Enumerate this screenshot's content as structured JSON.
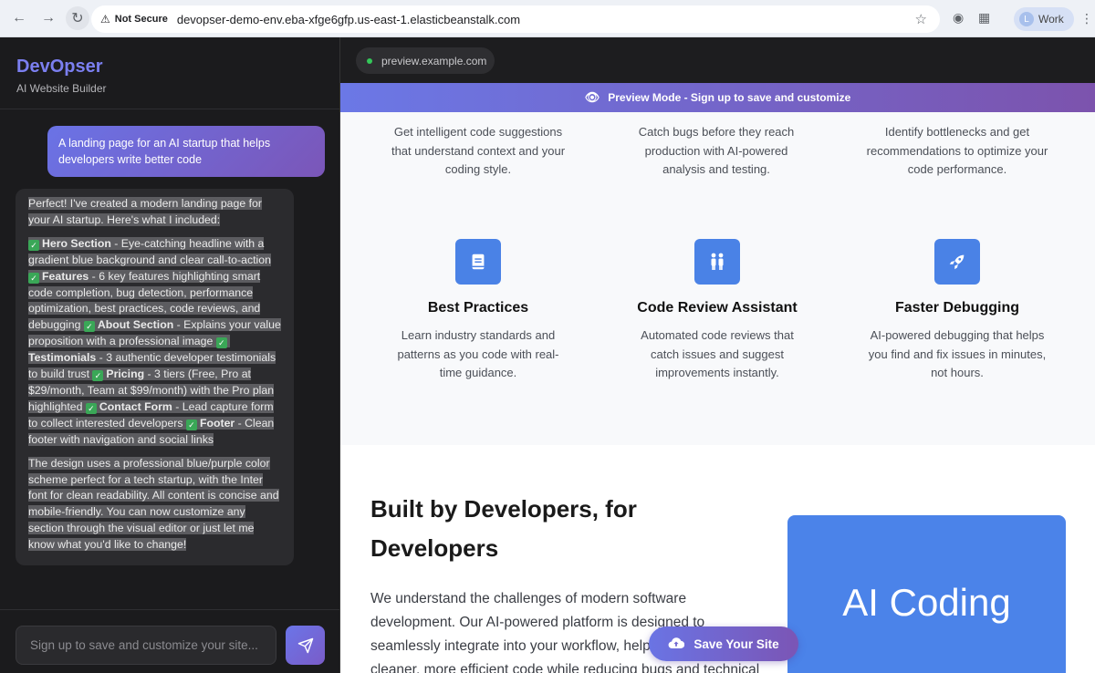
{
  "browser": {
    "security_label": "Not Secure",
    "url": "devopser-demo-env.eba-xfge6gfp.us-east-1.elasticbeanstalk.com",
    "profile_initial": "L",
    "profile_name": "Work",
    "icons": [
      "back-icon",
      "forward-icon",
      "reload-icon",
      "warning-icon",
      "star-icon",
      "extension-icon",
      "puzzle-icon",
      "menu-icon"
    ]
  },
  "sidebar": {
    "brand": "DevOpser",
    "subtitle": "AI Website Builder",
    "user_message": "A landing page for an AI startup that helps developers write better code",
    "ai_message": {
      "intro": "Perfect! I've created a modern landing page for your AI startup. Here's what I included:",
      "items": [
        {
          "title": "Hero Section",
          "text": " - Eye-catching headline with a gradient blue background and clear call-to-action"
        },
        {
          "title": "Features",
          "text": " - 6 key features highlighting smart code completion, bug detection, performance optimization, best practices, code reviews, and debugging "
        },
        {
          "title": "About Section",
          "text": " - Explains your value proposition with a professional image "
        },
        {
          "title": "Testimonials",
          "text": " - 3 authentic developer testimonials to build trust "
        },
        {
          "title": "Pricing",
          "text": " - 3 tiers (Free, Pro at $29/month, Team at $99/month) with the Pro plan highlighted "
        },
        {
          "title": "Contact Form",
          "text": " - Lead capture form to collect interested developers "
        },
        {
          "title": "Footer",
          "text": " - Clean footer with navigation and social links"
        }
      ],
      "outro": "The design uses a professional blue/purple color scheme perfect for a tech startup, with the Inter font for clean readability. All content is concise and mobile-friendly. You can now customize any section through the visual editor or just let me know what you'd like to change!"
    },
    "input_placeholder": "Sign up to save and customize your site..."
  },
  "preview": {
    "url": "preview.example.com",
    "banner": "Preview Mode - Sign up to save and customize",
    "top_features": [
      {
        "desc": "Get intelligent code suggestions that understand context and your coding style."
      },
      {
        "desc": "Catch bugs before they reach production with AI-powered analysis and testing."
      },
      {
        "desc": "Identify bottlenecks and get recommendations to optimize your code performance."
      }
    ],
    "features": [
      {
        "title": "Best Practices",
        "desc": "Learn industry standards and patterns as you code with real-time guidance.",
        "icon": "book-icon"
      },
      {
        "title": "Code Review Assistant",
        "desc": "Automated code reviews that catch issues and suggest improvements instantly.",
        "icon": "users-icon"
      },
      {
        "title": "Faster Debugging",
        "desc": "AI-powered debugging that helps you find and fix issues in minutes, not hours.",
        "icon": "rocket-icon"
      }
    ],
    "about": {
      "title": "Built by Developers, for Developers",
      "text": "We understand the challenges of modern software development. Our AI-powered platform is designed to seamlessly integrate into your workflow, helping you write cleaner, more efficient code while reducing bugs and technical debt. Whether you're a solo",
      "image_text": "AI Coding"
    },
    "save_button": "Save Your Site"
  },
  "colors": {
    "accent": "#6b75e8",
    "accent_purple": "#7b55b5",
    "feature_icon": "#4a82e6",
    "sidebar_bg": "#1b1b1d"
  }
}
